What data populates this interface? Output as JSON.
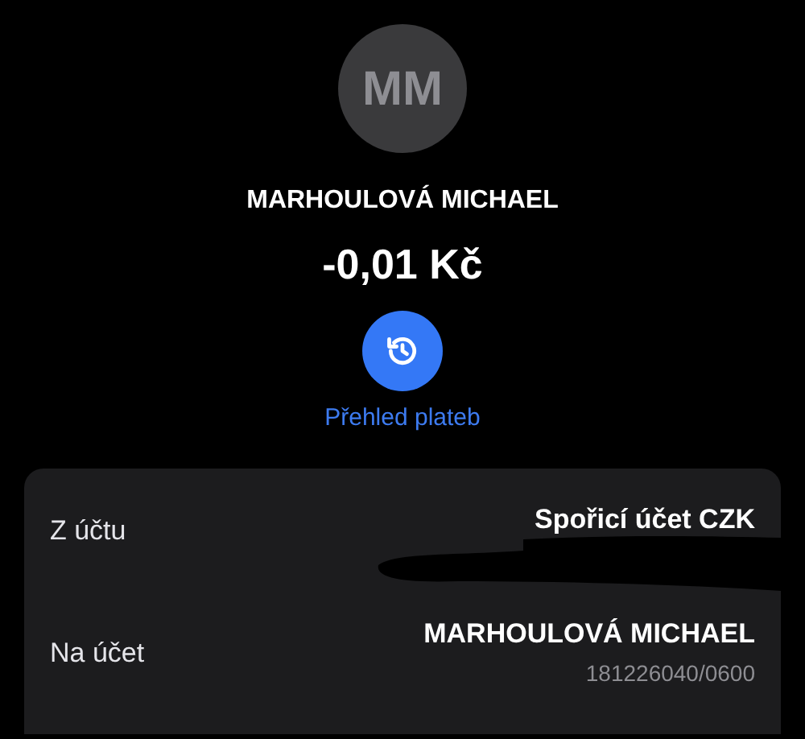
{
  "header": {
    "initials": "MM",
    "name": "MARHOULOVÁ MICHAEL",
    "amount": "-0,01 Kč",
    "history_link": "Přehled plateb"
  },
  "details": [
    {
      "label": "Z účtu",
      "value": "Spořicí účet CZK",
      "redacted": true
    },
    {
      "label": "Na účet",
      "value": "MARHOULOVÁ MICHAEL",
      "sub": "181226040/0600",
      "redacted": false
    }
  ]
}
